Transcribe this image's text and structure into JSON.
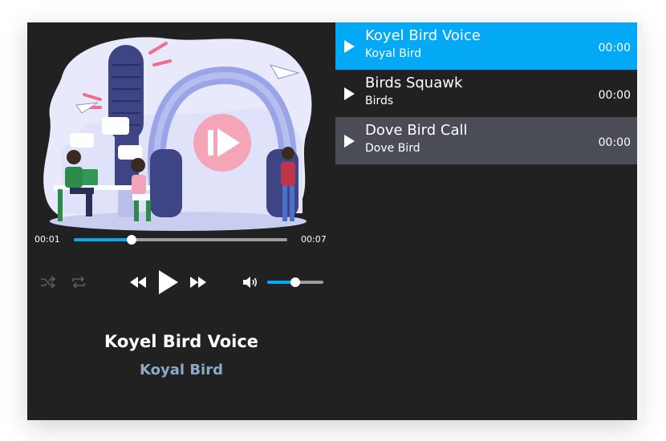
{
  "player": {
    "current_time": "00:01",
    "duration": "00:07",
    "progress": 0.27,
    "volume": 0.5,
    "now_playing": {
      "title": "Koyel Bird Voice",
      "artist": "Koyal Bird"
    }
  },
  "playlist": {
    "tracks": [
      {
        "title": "Koyel Bird Voice",
        "artist": "Koyal Bird",
        "duration": "00:00",
        "state": "active"
      },
      {
        "title": "Birds Squawk",
        "artist": "Birds",
        "duration": "00:00",
        "state": "normal"
      },
      {
        "title": "Dove Bird Call",
        "artist": "Dove Bird",
        "duration": "00:00",
        "state": "hover"
      }
    ]
  },
  "colors": {
    "background": "#212121",
    "accent": "#03a9f4",
    "active_row": "#03a9f4",
    "hover_row": "#4a4d55",
    "artist_text": "#8ba9c8"
  },
  "icons": [
    "shuffle-icon",
    "repeat-icon",
    "rewind-icon",
    "play-icon",
    "fast-forward-icon",
    "volume-icon",
    "podcast-illustration"
  ]
}
